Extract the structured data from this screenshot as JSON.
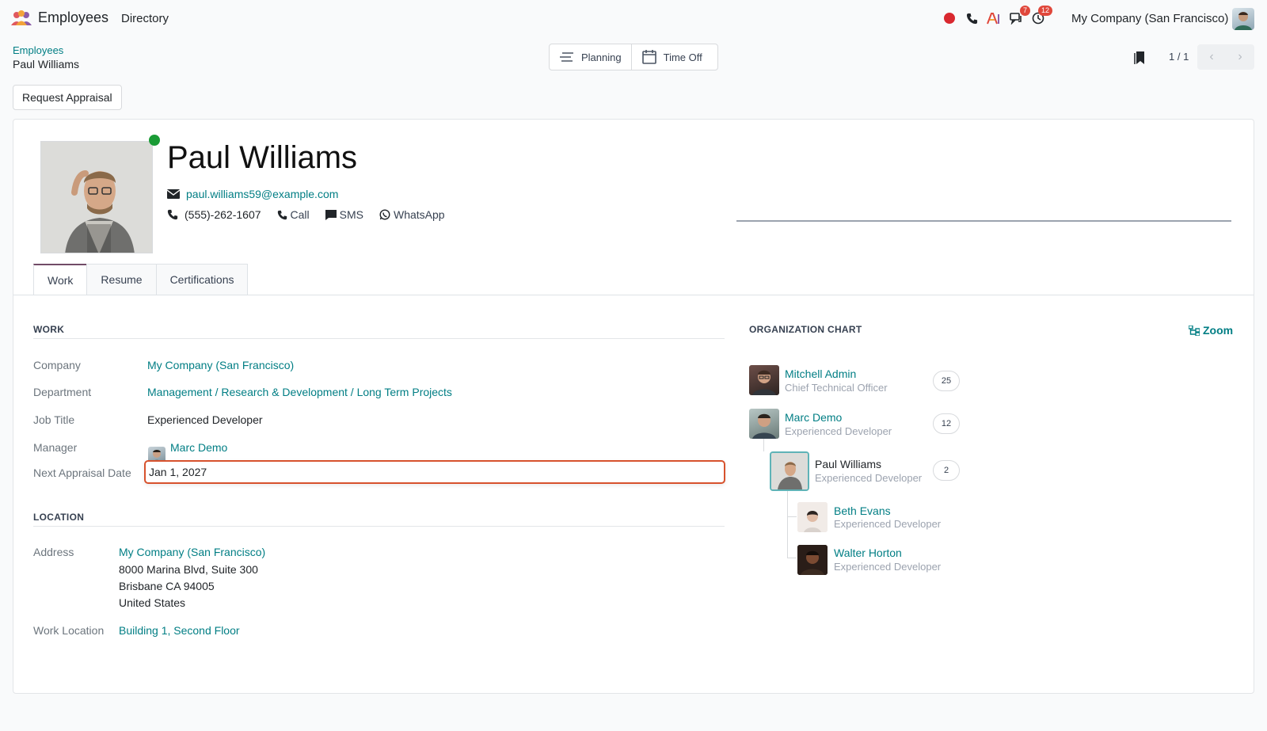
{
  "topbar": {
    "app_name": "Employees",
    "menu_directory": "Directory",
    "messages_badge": "7",
    "activities_badge": "12",
    "company": "My Company (San Francisco)"
  },
  "breadcrumb": {
    "parent": "Employees",
    "current": "Paul Williams"
  },
  "smart_buttons": {
    "planning": "Planning",
    "time_off": "Time Off"
  },
  "pager": {
    "value": "1 / 1"
  },
  "actions": {
    "request_appraisal": "Request Appraisal"
  },
  "employee": {
    "name": "Paul Williams",
    "email": "paul.williams59@example.com",
    "phone": "(555)-262-1607",
    "call": "Call",
    "sms": "SMS",
    "whatsapp": "WhatsApp",
    "status_color": "#1a9b35"
  },
  "tabs": [
    "Work",
    "Resume",
    "Certifications"
  ],
  "work": {
    "section_title": "WORK",
    "company_label": "Company",
    "company_value": "My Company (San Francisco)",
    "department_label": "Department",
    "department_value": "Management / Research & Development / Long Term Projects",
    "job_title_label": "Job Title",
    "job_title_value": "Experienced Developer",
    "manager_label": "Manager",
    "manager_value": "Marc Demo",
    "appraisal_label": "Next Appraisal Date",
    "appraisal_value": "Jan 1, 2027"
  },
  "location": {
    "section_title": "LOCATION",
    "address_label": "Address",
    "address_company": "My Company (San Francisco)",
    "address_line1": "8000 Marina Blvd, Suite 300",
    "address_line2": "Brisbane CA 94005",
    "address_line3": "United States",
    "work_location_label": "Work Location",
    "work_location_value": "Building 1, Second Floor"
  },
  "org_chart": {
    "title": "ORGANIZATION CHART",
    "zoom": "Zoom",
    "people": [
      {
        "name": "Mitchell Admin",
        "title": "Chief Technical Officer",
        "count": "25"
      },
      {
        "name": "Marc Demo",
        "title": "Experienced Developer",
        "count": "12"
      },
      {
        "name": "Paul Williams",
        "title": "Experienced Developer",
        "count": "2"
      },
      {
        "name": "Beth Evans",
        "title": "Experienced Developer"
      },
      {
        "name": "Walter Horton",
        "title": "Experienced Developer"
      }
    ]
  },
  "colors": {
    "accent": "#017e84",
    "brand": "#714b67",
    "focus": "#d7522d"
  }
}
